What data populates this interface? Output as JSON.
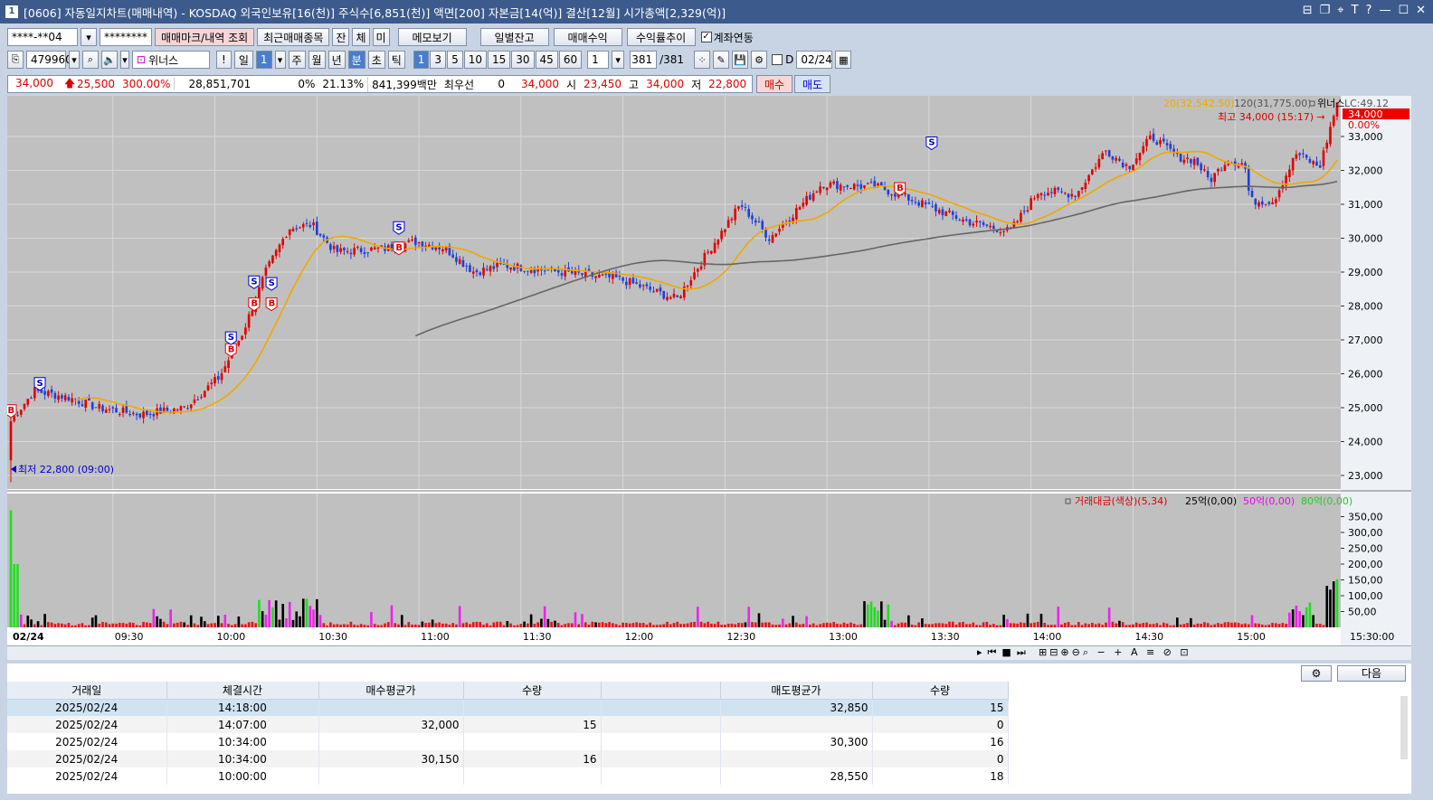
{
  "window": {
    "number": "1",
    "title": "[0606] 자동일지차트(매매내역) - KOSDAQ 외국인보유[16(천)] 주식수[6,851(천)] 액면[200] 자본금[14(억)] 결산[12월] 시가총액[2,329(억)]"
  },
  "toolbar1": {
    "account": "****-**04",
    "password": "********",
    "btn_mark": "매매마크/내역 조회",
    "btn_recent": "최근매매종목",
    "btn_jan": "잔",
    "btn_che": "체",
    "btn_mi": "미",
    "btn_memo": "메모보기",
    "btn_daily": "일별잔고",
    "btn_profit": "매매수익",
    "btn_rate": "수익률추이",
    "chk_link": "계좌연동"
  },
  "toolbar2": {
    "code": "479960",
    "name": "위너스",
    "excl": "!",
    "period_il": "일",
    "period_num": "1",
    "ju": "주",
    "wol": "월",
    "nyeon": "년",
    "bun": "분",
    "cho": "초",
    "tik": "틱",
    "intervals": [
      "1",
      "3",
      "5",
      "10",
      "15",
      "30",
      "45",
      "60"
    ],
    "interval_sel": "1",
    "count": "381",
    "count_total": "/381",
    "d_label": "D",
    "date": "02/24"
  },
  "quote": {
    "price": "34,000",
    "change": "25,500",
    "rate": "300.00%",
    "volume": "28,851,701",
    "pct1": "0%",
    "pct2": "21.13%",
    "amount": "841,399백만",
    "best": "최우선",
    "zero": "0",
    "best_price": "34,000",
    "open_label": "시",
    "open": "23,450",
    "high_label": "고",
    "high": "34,000",
    "low_label": "저",
    "low": "22,800",
    "buy": "매수",
    "sell": "매도"
  },
  "chart_data": {
    "type": "line",
    "legend_ma20": "20(32,542.50)",
    "legend_ma120": "120(31,775.00)",
    "legend_name": "위너스",
    "legend_lc": "LC:49.12",
    "last_price_tag": "34,000",
    "pct_tag": "0.00%",
    "high_annot": "최고 34,000 (15:17)",
    "low_annot": "최저 22,800 (09:00)",
    "y_ticks": [
      "33,000",
      "32,000",
      "31,000",
      "30,000",
      "29,000",
      "28,000",
      "27,000",
      "26,000",
      "25,000",
      "24,000",
      "23,000"
    ],
    "ylim": [
      22600,
      34200
    ],
    "x_labels": [
      "02/24",
      "09:30",
      "10:00",
      "10:30",
      "11:00",
      "11:30",
      "12:00",
      "12:30",
      "13:00",
      "13:30",
      "14:00",
      "14:30",
      "15:00",
      "15:30:00"
    ],
    "vol_legend": [
      "거래대금(색상)(5,34)",
      "25억(0,00)",
      "50억(0,00)",
      "80억(0,00)"
    ],
    "vol_ticks": [
      "350,00",
      "300,00",
      "250,00",
      "200,00",
      "150,00",
      "100,00",
      "50,00"
    ],
    "colors": {
      "up": "#e00000",
      "down": "#1f3fd8",
      "ma20": "#f0a800",
      "ma120": "#666666",
      "vol_green": "#22dd22",
      "vol_magenta": "#ee22ee",
      "vol_black": "#000000",
      "vol_red": "#ee1111"
    },
    "marks": [
      {
        "t": "B",
        "time": 0,
        "price": 24900
      },
      {
        "t": "S",
        "time": 10,
        "price": 25700
      },
      {
        "t": "B",
        "time": 76,
        "price": 26700
      },
      {
        "t": "S",
        "time": 76,
        "price": 27050
      },
      {
        "t": "B",
        "time": 84,
        "price": 28050
      },
      {
        "t": "S",
        "time": 84,
        "price": 28700
      },
      {
        "t": "B",
        "time": 90,
        "price": 28050
      },
      {
        "t": "S",
        "time": 90,
        "price": 28650
      },
      {
        "t": "B",
        "time": 134,
        "price": 29700
      },
      {
        "t": "S",
        "time": 134,
        "price": 30300
      },
      {
        "t": "B",
        "time": 307,
        "price": 31450
      },
      {
        "t": "S",
        "time": 318,
        "price": 32800
      }
    ]
  },
  "bottom": {
    "next": "다음",
    "columns": [
      "거래일",
      "체결시간",
      "매수평균가",
      "수량",
      "",
      "매도평균가",
      "수량"
    ],
    "rows": [
      [
        "2025/02/24",
        "14:18:00",
        "",
        "",
        "",
        "32,850",
        "15"
      ],
      [
        "2025/02/24",
        "14:07:00",
        "32,000",
        "15",
        "",
        "",
        "0"
      ],
      [
        "2025/02/24",
        "10:34:00",
        "",
        "",
        "",
        "30,300",
        "16"
      ],
      [
        "2025/02/24",
        "10:34:00",
        "30,150",
        "16",
        "",
        "",
        "0"
      ],
      [
        "2025/02/24",
        "10:00:00",
        "",
        "",
        "",
        "28,550",
        "18"
      ]
    ]
  }
}
